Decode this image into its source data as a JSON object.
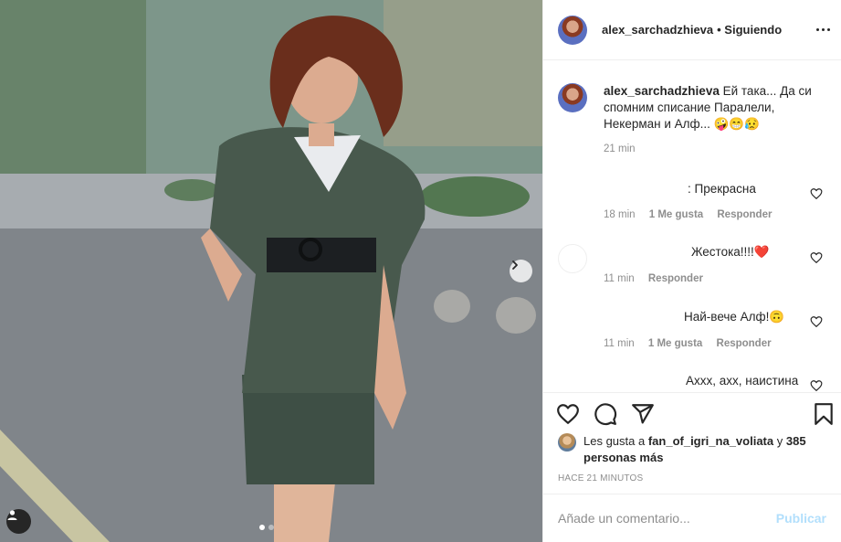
{
  "post": {
    "username": "alex_sarchadzhieva",
    "follow_label": "• Siguiendo",
    "caption_text": "Ей така... Да си спомним списание Паралели, Некерман и Алф...",
    "caption_emoji": "🤪😁😥",
    "caption_time": "21 min"
  },
  "comments": [
    {
      "text": ": Прекрасна",
      "time": "18 min",
      "likes": "1 Me gusta",
      "reply": "Responder"
    },
    {
      "text": "Жестока!!!!",
      "emoji": "❤️",
      "time": "11 min",
      "reply": "Responder"
    },
    {
      "text": "Най-вече Алф!",
      "emoji": "🙃",
      "time": "11 min",
      "likes": "1 Me gusta",
      "reply": "Responder"
    },
    {
      "text": "Ахxx, axx, наистина"
    }
  ],
  "likes": {
    "prefix": "Les gusta a",
    "user": "fan_of_igri_na_voliata",
    "connector": "y",
    "others": "385 personas más"
  },
  "timestamp": "HACE 21 MINUTOS",
  "comment_box": {
    "placeholder": "Añade un comentario...",
    "publish_label": "Publicar"
  },
  "colors": {
    "text": "#262626",
    "muted": "#8e8e8e",
    "publish_disabled": "#b2dffc",
    "heart": "#ed4956"
  },
  "carousel": {
    "slides": 2,
    "active": 1
  }
}
